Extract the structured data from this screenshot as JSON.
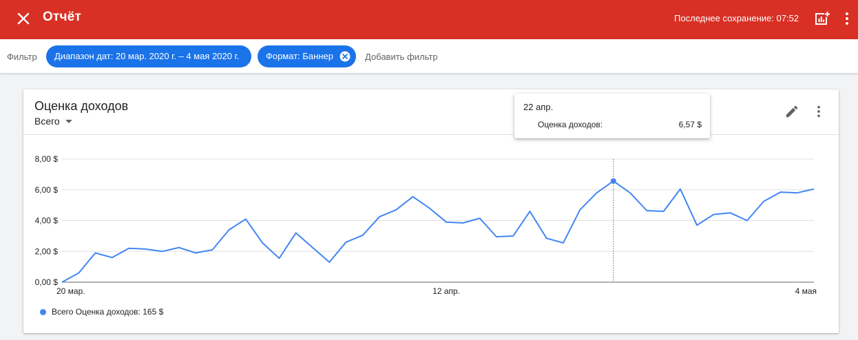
{
  "appbar": {
    "title": "Отчёт",
    "saved": "Последнее сохранение: 07:52",
    "color": "#d93025",
    "icons": [
      "close-icon",
      "add-chart-icon",
      "more-vert-icon"
    ]
  },
  "filters": {
    "label": "Фильтр",
    "chips": [
      {
        "label": "Диапазон дат: 20 мар. 2020 г. – 4 мая 2020 г."
      },
      {
        "label": "Формат: Баннер"
      }
    ],
    "add_label": "Добавить фильтр",
    "chip_color": "#1a73e8"
  },
  "card": {
    "title": "Оценка доходов",
    "metric_selector": "Всего",
    "legend": "Всего Оценка доходов: 165 $"
  },
  "tooltip": {
    "date": "22 апр.",
    "label": "Оценка доходов:",
    "value": "6,57 $"
  },
  "chart_data": {
    "type": "line",
    "color": "#4285f4",
    "ylim": [
      0,
      8
    ],
    "y_ticks": [
      "0,00 $",
      "2,00 $",
      "4,00 $",
      "6,00 $",
      "8,00 $"
    ],
    "x_tick_labels": [
      "20 мар.",
      "12 апр.",
      "4 мая"
    ],
    "x_tick_indices": [
      0,
      23,
      45
    ],
    "highlight_index": 33,
    "grid": true,
    "series": [
      {
        "values": [
          0.0,
          0.6,
          1.9,
          1.6,
          2.2,
          2.15,
          2.0,
          2.25,
          1.9,
          2.1,
          3.4,
          4.1,
          2.55,
          1.55,
          3.2,
          2.25,
          1.3,
          2.6,
          3.05,
          4.25,
          4.7,
          5.55,
          4.8,
          3.9,
          3.85,
          4.15,
          2.95,
          3.0,
          4.6,
          2.85,
          2.55,
          4.7,
          5.8,
          6.57,
          5.8,
          4.65,
          4.6,
          6.05,
          3.7,
          4.4,
          4.5,
          4.0,
          5.25,
          5.85,
          5.8,
          6.05
        ]
      }
    ]
  }
}
